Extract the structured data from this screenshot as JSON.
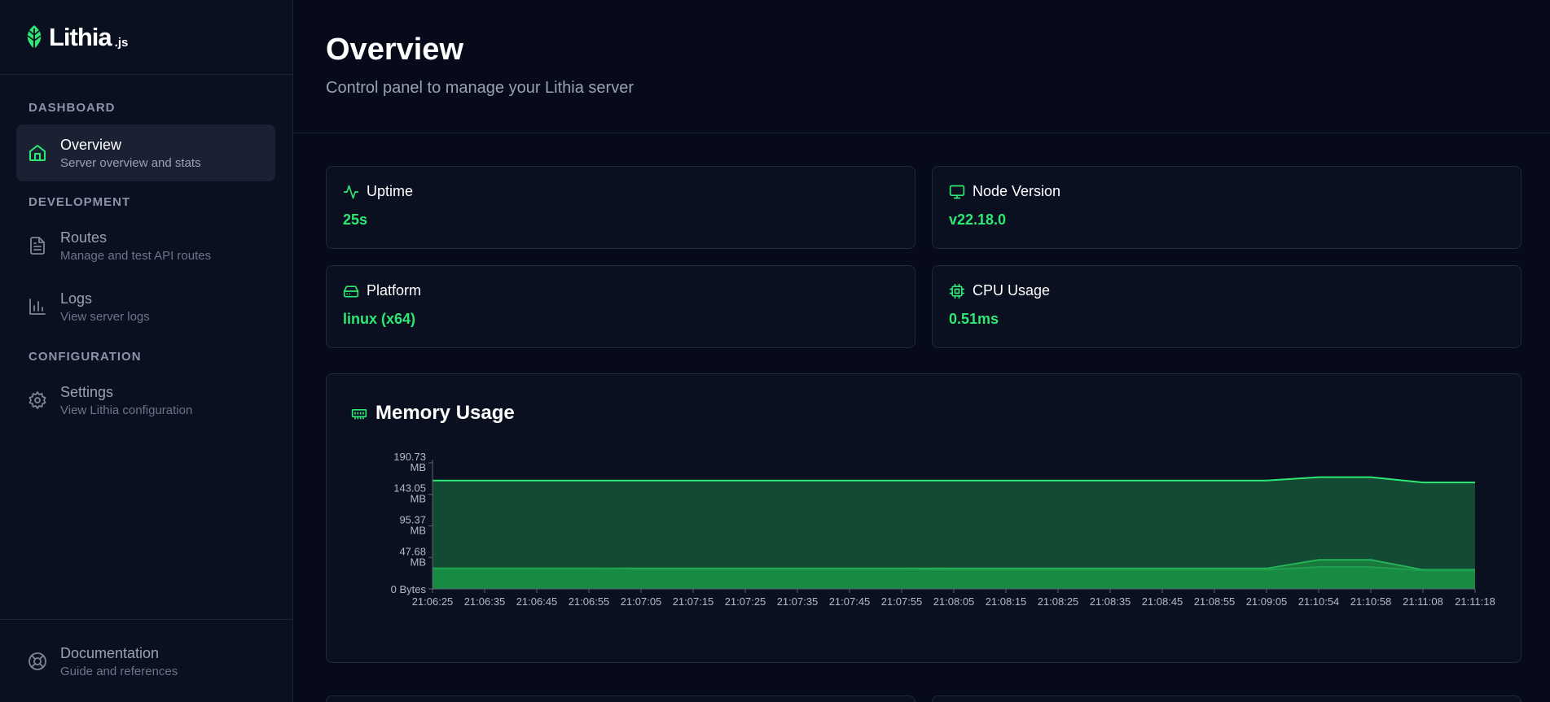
{
  "brand": {
    "name": "Lithia",
    "suffix": ".js"
  },
  "sidebar": {
    "sections": [
      {
        "title": "DASHBOARD"
      },
      {
        "title": "DEVELOPMENT"
      },
      {
        "title": "CONFIGURATION"
      }
    ],
    "items": [
      {
        "title": "Overview",
        "subtitle": "Server overview and stats",
        "icon": "home-icon",
        "active": true
      },
      {
        "title": "Routes",
        "subtitle": "Manage and test API routes",
        "icon": "file-icon",
        "active": false
      },
      {
        "title": "Logs",
        "subtitle": "View server logs",
        "icon": "bar-chart-icon",
        "active": false
      },
      {
        "title": "Settings",
        "subtitle": "View Lithia configuration",
        "icon": "gear-icon",
        "active": false
      }
    ],
    "footer": {
      "title": "Documentation",
      "subtitle": "Guide and references",
      "icon": "lifebuoy-icon"
    }
  },
  "header": {
    "title": "Overview",
    "subtitle": "Control panel to manage your Lithia server"
  },
  "stats": [
    {
      "label": "Uptime",
      "value": "25s",
      "icon": "activity-icon"
    },
    {
      "label": "Node Version",
      "value": "v22.18.0",
      "icon": "monitor-icon"
    },
    {
      "label": "Platform",
      "value": "linux (x64)",
      "icon": "hard-drive-icon"
    },
    {
      "label": "CPU Usage",
      "value": "0.51ms",
      "icon": "cpu-icon"
    }
  ],
  "colors": {
    "accent": "#2ee874",
    "background": "#060a19",
    "card": "#0a1020",
    "border": "#1f2a3e"
  },
  "memory_chart": {
    "title": "Memory Usage",
    "icon": "memory-icon"
  },
  "chart_data": {
    "type": "area",
    "title": "Memory Usage",
    "xlabel": "",
    "ylabel": "",
    "ylim": [
      0,
      190.73
    ],
    "y_ticks": [
      {
        "value": 190.73,
        "label": [
          "190.73",
          "MB"
        ]
      },
      {
        "value": 143.05,
        "label": [
          "143.05",
          "MB"
        ]
      },
      {
        "value": 95.37,
        "label": [
          "95.37",
          "MB"
        ]
      },
      {
        "value": 47.68,
        "label": [
          "47.68",
          "MB"
        ]
      },
      {
        "value": 0,
        "label": [
          "0 Bytes"
        ]
      }
    ],
    "x": [
      "21:06:25",
      "21:06:35",
      "21:06:45",
      "21:06:55",
      "21:07:05",
      "21:07:15",
      "21:07:25",
      "21:07:35",
      "21:07:45",
      "21:07:55",
      "21:08:05",
      "21:08:15",
      "21:08:25",
      "21:08:35",
      "21:08:45",
      "21:08:55",
      "21:09:05",
      "21:10:54",
      "21:10:58",
      "21:11:08",
      "21:11:18"
    ],
    "series": [
      {
        "values": [
          164,
          164,
          164,
          164,
          164,
          164,
          164,
          164,
          164,
          164,
          164,
          164,
          164,
          164,
          164,
          164,
          164,
          169,
          169,
          161,
          161
        ],
        "color": "#2ee874",
        "fill": "#124a34"
      },
      {
        "values": [
          31,
          31,
          31,
          31,
          31,
          31,
          31,
          31,
          31,
          31,
          31,
          31,
          31,
          31,
          31,
          31,
          31,
          44,
          44,
          29,
          29
        ],
        "color": "#26b259",
        "fill": "#1a7a3e"
      },
      {
        "values": [
          31,
          31,
          31,
          31,
          30,
          30,
          30,
          30,
          30,
          30,
          29,
          29,
          29,
          29,
          29,
          29,
          29,
          33,
          33,
          28,
          28
        ],
        "color": "#1f9f4d",
        "fill": "#178a43"
      }
    ],
    "grid": false,
    "legend": "none"
  }
}
